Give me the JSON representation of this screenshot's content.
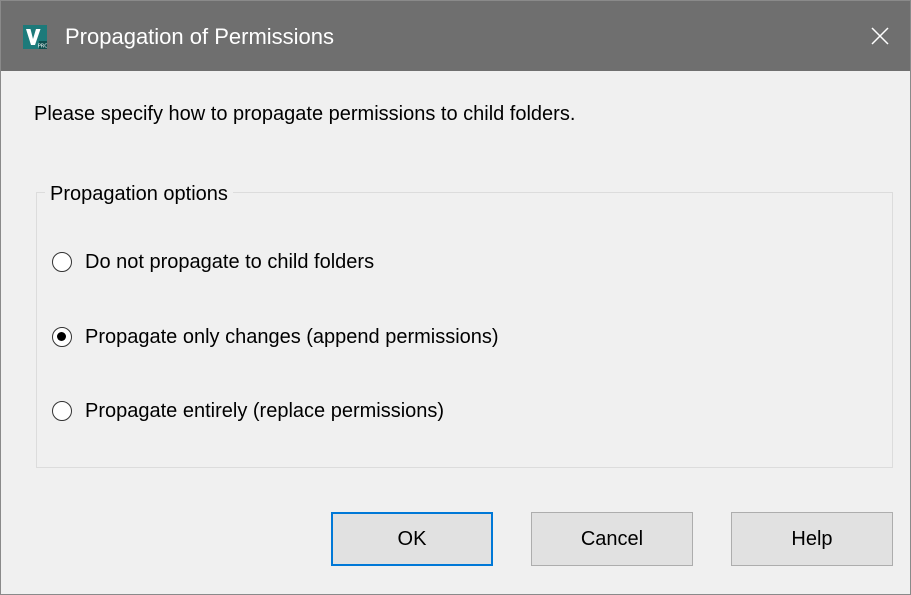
{
  "window": {
    "title": "Propagation of Permissions",
    "app_icon": "vault-pro-app-icon",
    "close_icon": "close-icon"
  },
  "prompt": "Please specify how to propagate permissions to child folders.",
  "propagation_options": {
    "legend": "Propagation options",
    "options": [
      {
        "label": "Do not propagate to child folders",
        "selected": false
      },
      {
        "label": "Propagate only changes (append permissions)",
        "selected": true
      },
      {
        "label": "Propagate entirely (replace permissions)",
        "selected": false
      }
    ]
  },
  "buttons": {
    "ok": "OK",
    "cancel": "Cancel",
    "help": "Help"
  },
  "colors": {
    "titlebar": "#6f6f6f",
    "default_button_border": "#0078d7",
    "app_icon_teal": "#1d7a7a"
  }
}
